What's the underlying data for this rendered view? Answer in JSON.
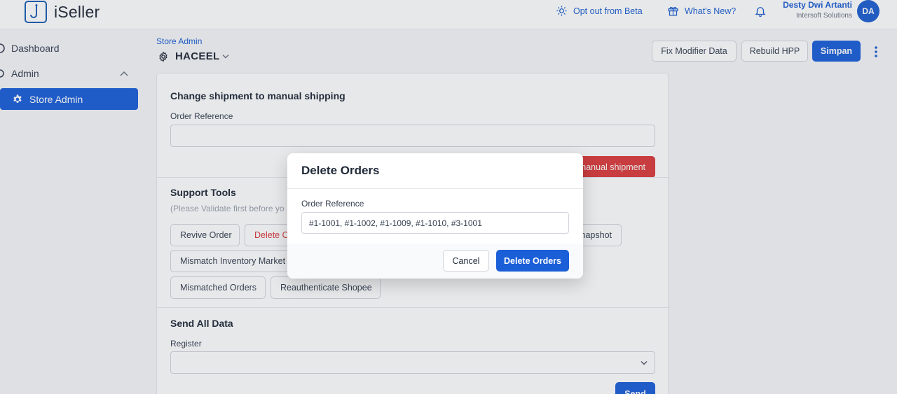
{
  "app": {
    "logo_text": "iSeller"
  },
  "topbar": {
    "opt_out_label": "Opt out from Beta",
    "whats_new_label": "What's New?",
    "user_name": "Desty Dwi Artanti",
    "user_org": "Intersoft Solutions",
    "avatar_initials": "DA"
  },
  "sidebar": {
    "items": [
      {
        "label": "Dashboard",
        "icon": "dashboard-icon"
      },
      {
        "label": "Admin",
        "icon": "admin-icon"
      },
      {
        "label": "Store Admin",
        "icon": "gear-icon"
      }
    ]
  },
  "page": {
    "breadcrumb": "Store Admin",
    "store_name": "HACEEL",
    "actions": {
      "fix_modifier": "Fix Modifier Data",
      "rebuild_hpp": "Rebuild HPP",
      "save": "Simpan"
    }
  },
  "sections": {
    "manual_shipping": {
      "title": "Change shipment to manual shipping",
      "field_label": "Order Reference",
      "button_label": "manual shipment"
    },
    "support_tools": {
      "title": "Support Tools",
      "note": "(Please Validate first before yo",
      "tools": [
        "Revive Order",
        "Delete O",
        "napshot",
        "Mismatch Inventory Market",
        "Mismatched Orders",
        "Reauthenticate Shopee"
      ]
    },
    "send_all_data": {
      "title": "Send All Data",
      "field_label": "Register",
      "button_label": "Send"
    }
  },
  "modal": {
    "title": "Delete Orders",
    "field_label": "Order Reference",
    "field_value": "#1-1001, #1-1002, #1-1009, #1-1010, #3-1001",
    "cancel_label": "Cancel",
    "confirm_label": "Delete Orders"
  },
  "colors": {
    "primary": "#1b5fd8",
    "danger": "#dc3b3b",
    "link": "#1d5fd0"
  }
}
